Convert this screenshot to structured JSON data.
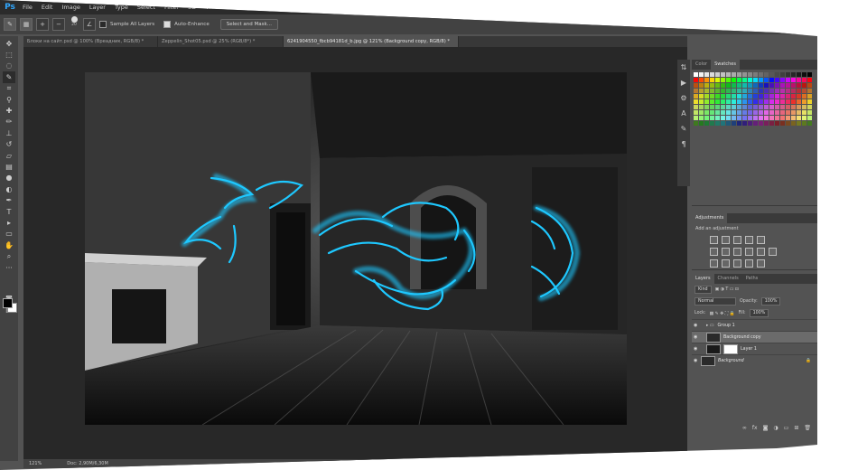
{
  "app": {
    "logo": "Ps"
  },
  "menu": [
    "File",
    "Edit",
    "Image",
    "Layer",
    "Type",
    "Select",
    "Filter",
    "3D",
    "View",
    "Window",
    "Help"
  ],
  "options": {
    "brush_size": "20",
    "sample_all_layers": "Sample All Layers",
    "auto_enhance": "Auto-Enhance",
    "select_and_mask": "Select and Mask..."
  },
  "tabs": [
    {
      "label": "Блоки на сайт.psd @ 100% (Вреадник, RGB/8) *"
    },
    {
      "label": "Zeppelin_Shot05.psd @ 25% (RGB/8*) *"
    },
    {
      "label": "6241904550_fbcb94181d_b.jpg @ 121% (Background copy, RGB/8) *"
    }
  ],
  "status": {
    "zoom": "121%",
    "doc": "Doc: 2,90M/6,30M"
  },
  "color_panel": {
    "tab_color": "Color",
    "tab_swatches": "Swatches"
  },
  "adjustments": {
    "title": "Adjustments",
    "subtitle": "Add an adjustment"
  },
  "layers_panel": {
    "tab_layers": "Layers",
    "tab_channels": "Channels",
    "tab_paths": "Paths",
    "kind": "Kind",
    "blend_mode": "Normal",
    "opacity_label": "Opacity:",
    "opacity_value": "100%",
    "lock_label": "Lock:",
    "fill_label": "Fill:",
    "fill_value": "100%",
    "layers": [
      {
        "name": "Group 1"
      },
      {
        "name": "Background copy"
      },
      {
        "name": "Layer 1"
      },
      {
        "name": "Background"
      }
    ]
  },
  "icons": [
    "move-icon",
    "marquee-icon",
    "lasso-icon",
    "quick-selection-icon",
    "crop-icon",
    "eyedropper-icon",
    "healing-brush-icon",
    "brush-icon",
    "stamp-icon",
    "history-brush-icon",
    "eraser-icon",
    "gradient-icon",
    "blur-icon",
    "dodge-icon",
    "pen-icon",
    "type-icon",
    "path-selection-icon",
    "shape-icon",
    "hand-icon",
    "zoom-icon"
  ],
  "colors": {
    "accent": "#31a8ff",
    "glow": "#1ec8ff",
    "panel": "#535353",
    "dark": "#2b2b2b"
  }
}
